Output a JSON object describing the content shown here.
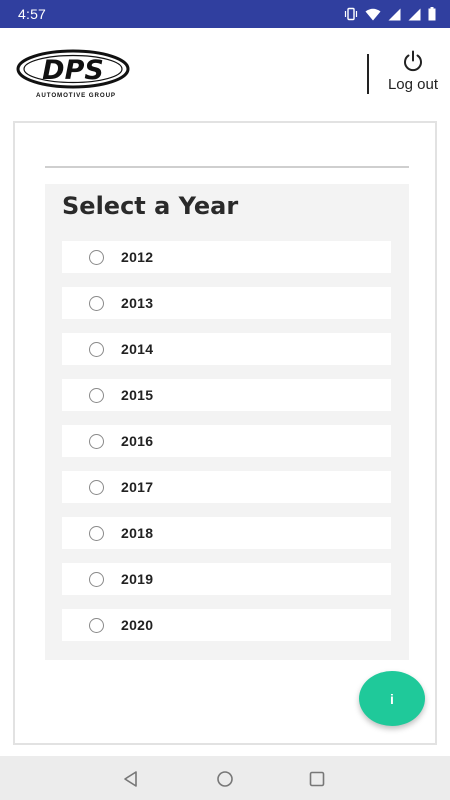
{
  "status_bar": {
    "time": "4:57",
    "icons": [
      "vibrate-icon",
      "wifi-icon",
      "signal-icon",
      "signal-icon-2",
      "battery-icon"
    ],
    "background": "#303f9f"
  },
  "header": {
    "logo_text": "DPS",
    "logo_subtitle": "AUTOMOTIVE GROUP",
    "logout_label": "Log out",
    "logout_icon": "power-icon"
  },
  "year_selector": {
    "title": "Select a Year",
    "options": [
      "2012",
      "2013",
      "2014",
      "2015",
      "2016",
      "2017",
      "2018",
      "2019",
      "2020"
    ],
    "selected": null
  },
  "fab": {
    "icon_label": "i",
    "color": "#1fc99a"
  },
  "nav_bar": {
    "buttons": [
      "back-icon",
      "home-icon",
      "recents-icon"
    ]
  }
}
